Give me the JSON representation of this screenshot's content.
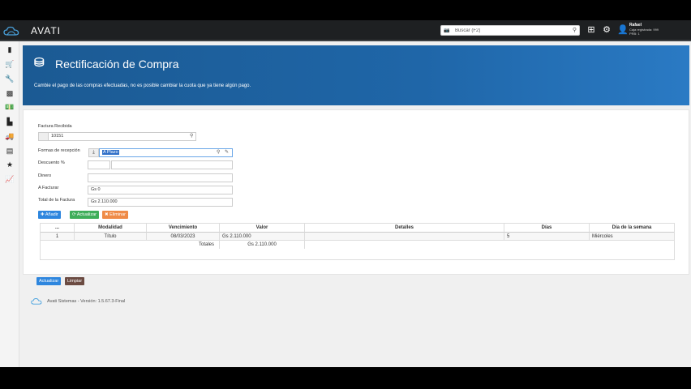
{
  "app": {
    "name": "AVATI"
  },
  "header": {
    "search_placeholder": "Buscar (F2)",
    "user": {
      "name": "Rafael",
      "line1": "Caja registrada: 999",
      "line2": "PRB: 1"
    },
    "icons": [
      "logo-cloud-icon",
      "camera-icon",
      "search-icon",
      "plus-square-icon",
      "gear-icon",
      "user-icon"
    ]
  },
  "sidebar": {
    "items": [
      {
        "name": "book-icon",
        "glyph": "▮"
      },
      {
        "name": "cart-icon",
        "glyph": "🛒"
      },
      {
        "name": "wrench-icon",
        "glyph": "🔧"
      },
      {
        "name": "cubes-icon",
        "glyph": "▩"
      },
      {
        "name": "money-icon",
        "glyph": "💵"
      },
      {
        "name": "industry-icon",
        "glyph": "▙"
      },
      {
        "name": "truck-icon",
        "glyph": "🚚"
      },
      {
        "name": "register-icon",
        "glyph": "▤"
      },
      {
        "name": "star-icon",
        "glyph": "★"
      },
      {
        "name": "chart-line-icon",
        "glyph": "📈"
      }
    ]
  },
  "banner": {
    "title": "Rectificación de Compra",
    "subtitle": "Cambie el pago de las compras efectuadas, no es posible cambiar la cuota que ya tiene algún pago."
  },
  "form": {
    "factura_label": "Factura Recibida",
    "factura_value": "10151",
    "formas_label": "Formas de recepción",
    "formas_value": "A Plazo",
    "descuento_label": "Descuento %",
    "descuento_value": "",
    "dinero_label": "Dinero",
    "dinero_value": "",
    "afacturar_label": "A Facturar",
    "afacturar_value": "Gs 0",
    "total_label": "Total de la Factura",
    "total_value": "Gs 2.110.000"
  },
  "buttons": {
    "add": "Añadir",
    "update": "Actualizar",
    "delete": "Eliminar",
    "bottom_update": "Actualizar",
    "clear": "Limpiar"
  },
  "table": {
    "headers": [
      "...",
      "Modalidad",
      "Vencimiento",
      "Valor",
      "Detalles",
      "Días",
      "Día de la semana"
    ],
    "rows": [
      [
        "1",
        "Título",
        "08/03/2023",
        "Gs 2.110.000",
        "",
        "5",
        "Miércoles"
      ]
    ],
    "totals_label": "Totales",
    "totals_value": "Gs 2.110.000"
  },
  "footer": {
    "text": "Avati Sistemas - Versión: 1.5.67.3-Final"
  },
  "colors": {
    "banner": "#1f66a8",
    "topbar": "#1e2022",
    "primary": "#2e86de",
    "success": "#3fae5a",
    "warning": "#ef8b47",
    "dark": "#6b4b42"
  }
}
